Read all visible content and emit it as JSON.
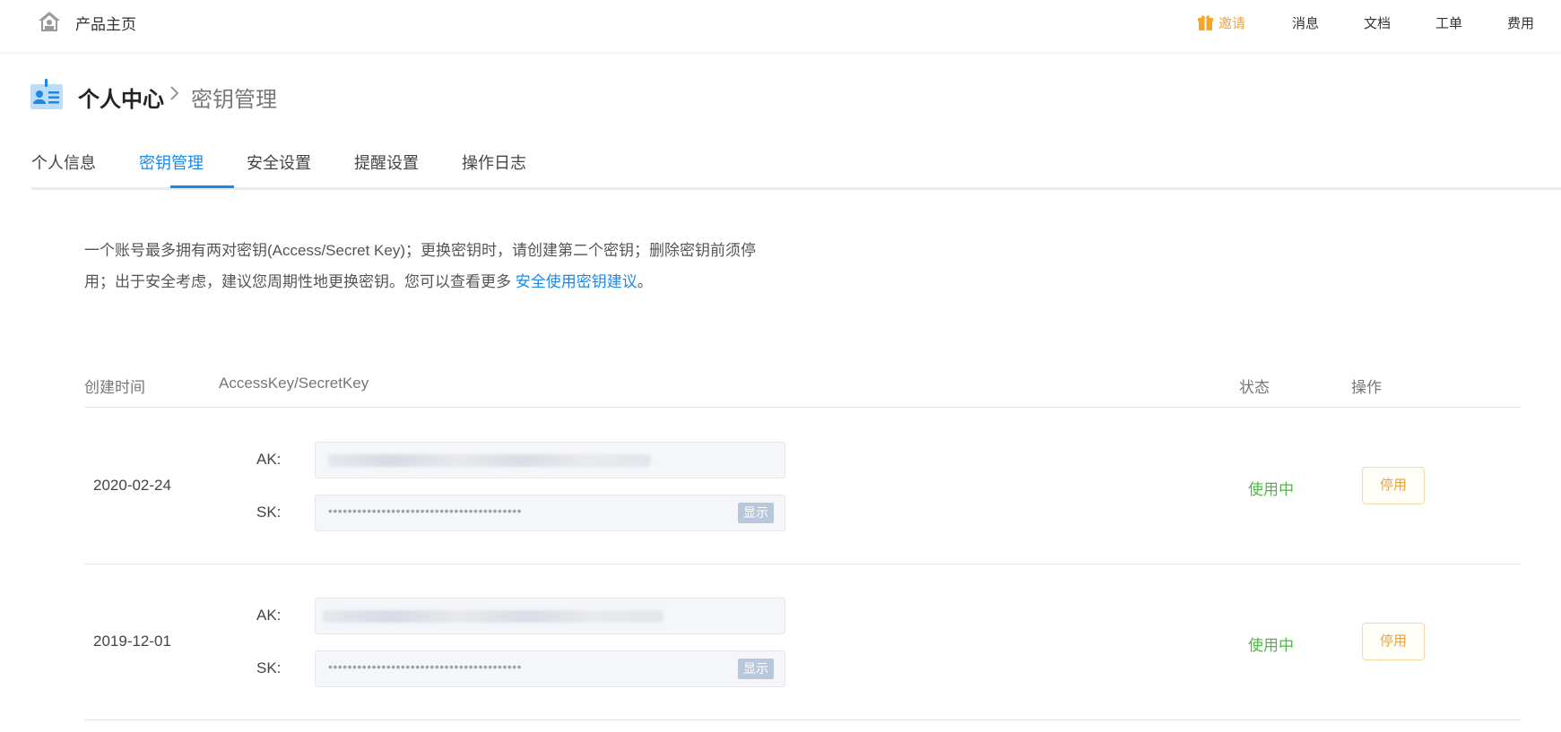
{
  "header": {
    "home_title": "产品主页",
    "invite_label": "邀请",
    "nav": [
      "消息",
      "文档",
      "工单",
      "费用"
    ],
    "accent_color": "#f5a623"
  },
  "breadcrumb": {
    "parent": "个人中心",
    "current": "密钥管理"
  },
  "tabs": [
    {
      "label": "个人信息",
      "active": false
    },
    {
      "label": "密钥管理",
      "active": true
    },
    {
      "label": "安全设置",
      "active": false
    },
    {
      "label": "提醒设置",
      "active": false
    },
    {
      "label": "操作日志",
      "active": false
    }
  ],
  "notice": {
    "line1": "一个账号最多拥有两对密钥(Access/Secret Key)；更换密钥时，请创建第二个密钥；删除密钥前须停",
    "line2_prefix": "用；出于安全考虑，建议您周期性地更换密钥。您可以查看更多 ",
    "link": "安全使用密钥建议",
    "line2_suffix": "。"
  },
  "table": {
    "headers": {
      "created": "创建时间",
      "keys": "AccessKey/SecretKey",
      "status": "状态",
      "action": "操作"
    },
    "rows": [
      {
        "date": "2020-02-24",
        "ak_label": "AK:",
        "sk_label": "SK:",
        "sk_masked": "••••••••••••••••••••••••••••••••••••••••",
        "show_label": "显示",
        "status": "使用中",
        "action": "停用"
      },
      {
        "date": "2019-12-01",
        "ak_label": "AK:",
        "sk_label": "SK:",
        "sk_masked": "••••••••••••••••••••••••••••••••••••••••",
        "show_label": "显示",
        "status": "使用中",
        "action": "停用"
      }
    ]
  },
  "colors": {
    "link": "#1e88e5",
    "status_active": "#52b44a",
    "disable_button": "#e8a33a"
  }
}
